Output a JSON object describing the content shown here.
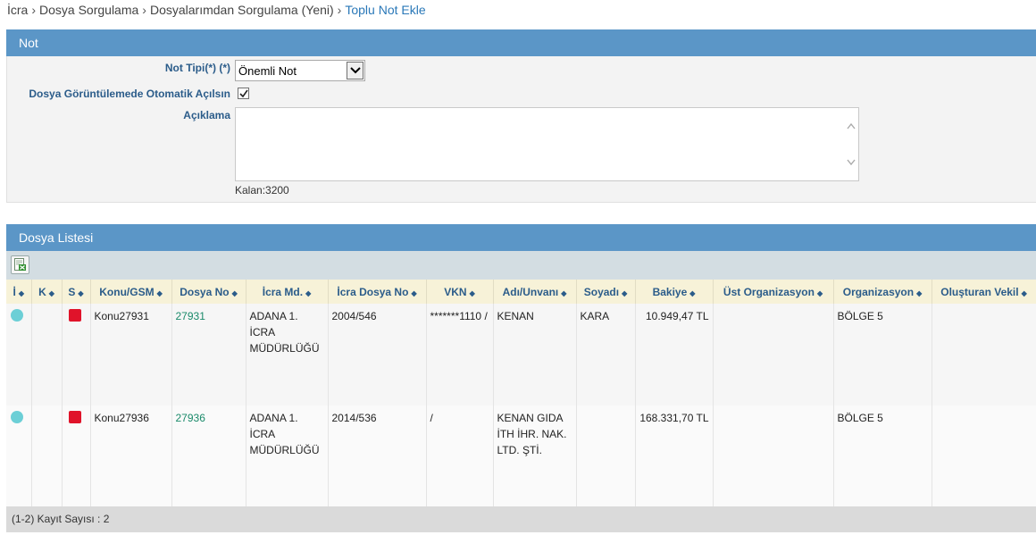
{
  "breadcrumb": {
    "items": [
      "İcra",
      "Dosya Sorgulama",
      "Dosyalarımdan Sorgulama (Yeni)"
    ],
    "current": "Toplu Not Ekle",
    "separator": "›"
  },
  "not_panel": {
    "title": "Not",
    "not_tipi_label": "Not Tipi(*) (*)",
    "not_tipi_value": "Önemli Not",
    "dosya_gor_label": "Dosya Görüntülemede Otomatik Açılsın",
    "dosya_gor_checked": true,
    "aciklama_label": "Açıklama",
    "aciklama_value": "",
    "kalan": "Kalan:3200"
  },
  "list_panel": {
    "title": "Dosya Listesi",
    "columns": [
      "İ",
      "K",
      "S",
      "Konu/GSM",
      "Dosya No",
      "İcra Md.",
      "İcra Dosya No",
      "VKN",
      "Adı/Unvanı",
      "Soyadı",
      "Bakiye",
      "Üst Organizasyon",
      "Organizasyon",
      "Oluşturan Vekil"
    ],
    "sort_icon": "◆",
    "rows": [
      {
        "konu": "Konu27931",
        "dosya_no": "27931",
        "icra_md": "ADANA 1. İCRA MÜDÜRLÜĞÜ",
        "icra_dosya_no": "2004/546",
        "vkn": "*******1110 /",
        "adi": "KENAN",
        "soyadi": "KARA",
        "bakiye": "10.949,47 TL",
        "ust_org": "",
        "org": "BÖLGE 5",
        "vekil": ""
      },
      {
        "konu": "Konu27936",
        "dosya_no": "27936",
        "icra_md": "ADANA 1. İCRA MÜDÜRLÜĞÜ",
        "icra_dosya_no": "2014/536",
        "vkn": "/",
        "adi": "KENAN GIDA İTH İHR. NAK. LTD. ŞTİ.",
        "soyadi": "",
        "bakiye": "168.331,70 TL",
        "ust_org": "",
        "org": "BÖLGE 5",
        "vekil": ""
      }
    ],
    "footer": "(1-2) Kayıt Sayısı : 2"
  },
  "colors": {
    "header": "#5b96c7",
    "link": "#1a8a6a",
    "status_dot": "#6ccfd6",
    "status_square": "#e0132a"
  },
  "icons": {
    "excel_export": "excel-export-icon",
    "select_arrow": "chevron-down-icon",
    "checkbox": "checkmark-icon"
  }
}
